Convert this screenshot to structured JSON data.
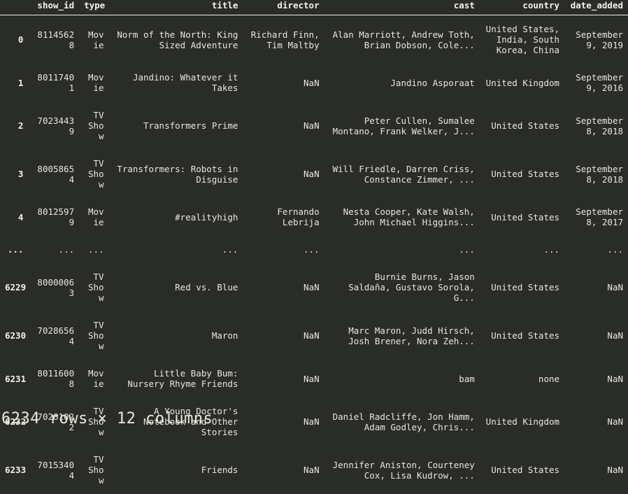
{
  "table": {
    "index_header": "",
    "columns": [
      "show_id",
      "type",
      "title",
      "director",
      "cast",
      "country",
      "date_added"
    ],
    "rows": [
      {
        "index": "0",
        "show_id": "81145628",
        "type": "Movie",
        "title": "Norm of the North: King Sized Adventure",
        "director": "Richard Finn, Tim Maltby",
        "cast": "Alan Marriott, Andrew Toth, Brian Dobson, Cole...",
        "country": "United States, India, South Korea, China",
        "date_added": "September 9, 2019"
      },
      {
        "index": "1",
        "show_id": "80117401",
        "type": "Movie",
        "title": "Jandino: Whatever it Takes",
        "director": "NaN",
        "cast": "Jandino Asporaat",
        "country": "United Kingdom",
        "date_added": "September 9, 2016"
      },
      {
        "index": "2",
        "show_id": "70234439",
        "type": "TV Show",
        "title": "Transformers Prime",
        "director": "NaN",
        "cast": "Peter Cullen, Sumalee Montano, Frank Welker, J...",
        "country": "United States",
        "date_added": "September 8, 2018"
      },
      {
        "index": "3",
        "show_id": "80058654",
        "type": "TV Show",
        "title": "Transformers: Robots in Disguise",
        "director": "NaN",
        "cast": "Will Friedle, Darren Criss, Constance Zimmer, ...",
        "country": "United States",
        "date_added": "September 8, 2018"
      },
      {
        "index": "4",
        "show_id": "80125979",
        "type": "Movie",
        "title": "#realityhigh",
        "director": "Fernando Lebrija",
        "cast": "Nesta Cooper, Kate Walsh, John Michael Higgins...",
        "country": "United States",
        "date_added": "September 8, 2017"
      },
      {
        "index": "...",
        "show_id": "...",
        "type": "...",
        "title": "...",
        "director": "...",
        "cast": "...",
        "country": "...",
        "date_added": "..."
      },
      {
        "index": "6229",
        "show_id": "80000063",
        "type": "TV Show",
        "title": "Red vs. Blue",
        "director": "NaN",
        "cast": "Burnie Burns, Jason Saldaña, Gustavo Sorola, G...",
        "country": "United States",
        "date_added": "NaN"
      },
      {
        "index": "6230",
        "show_id": "70286564",
        "type": "TV Show",
        "title": "Maron",
        "director": "NaN",
        "cast": "Marc Maron, Judd Hirsch, Josh Brener, Nora Zeh...",
        "country": "United States",
        "date_added": "NaN"
      },
      {
        "index": "6231",
        "show_id": "80116008",
        "type": "Movie",
        "title": "Little Baby Bum: Nursery Rhyme Friends",
        "director": "NaN",
        "cast": "bam",
        "country": "none",
        "date_added": "NaN"
      },
      {
        "index": "6232",
        "show_id": "70281022",
        "type": "TV Show",
        "title": "A Young Doctor's Notebook and Other Stories",
        "director": "NaN",
        "cast": "Daniel Radcliffe, Jon Hamm, Adam Godley, Chris...",
        "country": "United Kingdom",
        "date_added": "NaN"
      },
      {
        "index": "6233",
        "show_id": "70153404",
        "type": "TV Show",
        "title": "Friends",
        "director": "NaN",
        "cast": "Jennifer Aniston, Courteney Cox, Lisa Kudrow, ...",
        "country": "United States",
        "date_added": "NaN"
      }
    ]
  },
  "footer": {
    "shape_text": "6234 rows × 12 columns"
  },
  "colors": {
    "background": "#2a2d27",
    "text": "#e6e6de",
    "header_rule": "#f0f0e8"
  }
}
